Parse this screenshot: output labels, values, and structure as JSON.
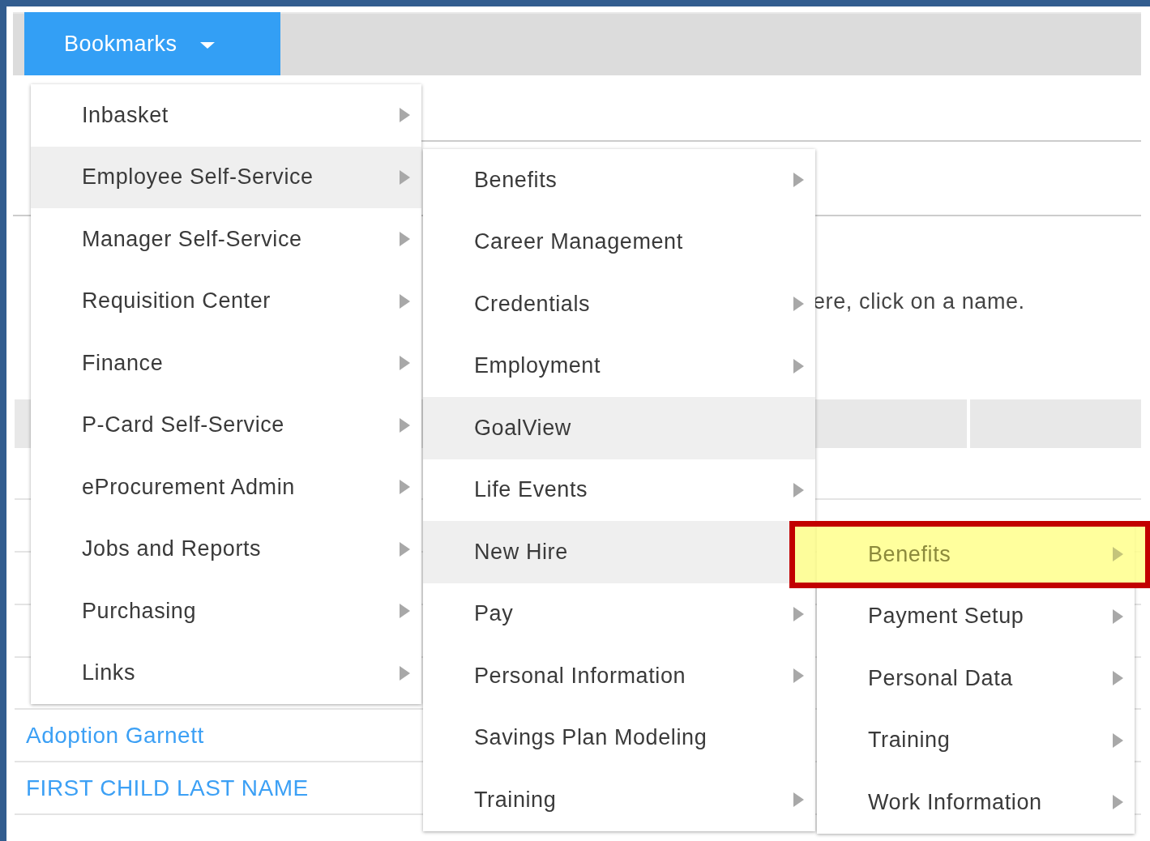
{
  "bookmarks_button": {
    "label": "Bookmarks",
    "expanded": true
  },
  "instruction": "ere, click on a name.",
  "links": [
    "Adoption Garnett",
    "FIRST CHILD LAST NAME"
  ],
  "menus": [
    {
      "kind": "hover",
      "items": [
        {
          "label": "Inbasket",
          "selected": false,
          "has_submenu": true
        },
        {
          "label": "Employee Self-Service",
          "selected": true,
          "has_submenu": true
        },
        {
          "label": "Manager Self-Service",
          "selected": false,
          "has_submenu": true
        },
        {
          "label": "Requisition Center",
          "selected": false,
          "has_submenu": true
        },
        {
          "label": "Finance",
          "selected": false,
          "has_submenu": true
        },
        {
          "label": "P-Card Self-Service",
          "selected": false,
          "has_submenu": true
        },
        {
          "label": "eProcurement Admin",
          "selected": false,
          "has_submenu": true
        },
        {
          "label": "Jobs and Reports",
          "selected": false,
          "has_submenu": true
        },
        {
          "label": "Purchasing",
          "selected": false,
          "has_submenu": true
        },
        {
          "label": "Links",
          "selected": false,
          "has_submenu": true
        }
      ]
    },
    {
      "kind": "hover",
      "items": [
        {
          "label": "Benefits",
          "selected": false,
          "has_submenu": true
        },
        {
          "label": "Career Management",
          "selected": false,
          "has_submenu": false
        },
        {
          "label": "Credentials",
          "selected": false,
          "has_submenu": true
        },
        {
          "label": "Employment",
          "selected": false,
          "has_submenu": true
        },
        {
          "label": "GoalView",
          "selected": true,
          "has_submenu": false
        },
        {
          "label": "Life Events",
          "selected": false,
          "has_submenu": true
        },
        {
          "label": "New Hire",
          "selected": true,
          "has_submenu": false
        },
        {
          "label": "Pay",
          "selected": false,
          "has_submenu": true
        },
        {
          "label": "Personal Information",
          "selected": false,
          "has_submenu": true
        },
        {
          "label": "Savings Plan Modeling",
          "selected": false,
          "has_submenu": false
        },
        {
          "label": "Training",
          "selected": false,
          "has_submenu": true
        }
      ]
    },
    {
      "kind": "marked",
      "items": [
        {
          "label": "Benefits",
          "selected": true,
          "has_submenu": true
        },
        {
          "label": "Payment Setup",
          "selected": false,
          "has_submenu": true
        },
        {
          "label": "Personal Data",
          "selected": false,
          "has_submenu": true
        },
        {
          "label": "Training",
          "selected": false,
          "has_submenu": true
        },
        {
          "label": "Work Information",
          "selected": false,
          "has_submenu": true
        }
      ]
    }
  ]
}
